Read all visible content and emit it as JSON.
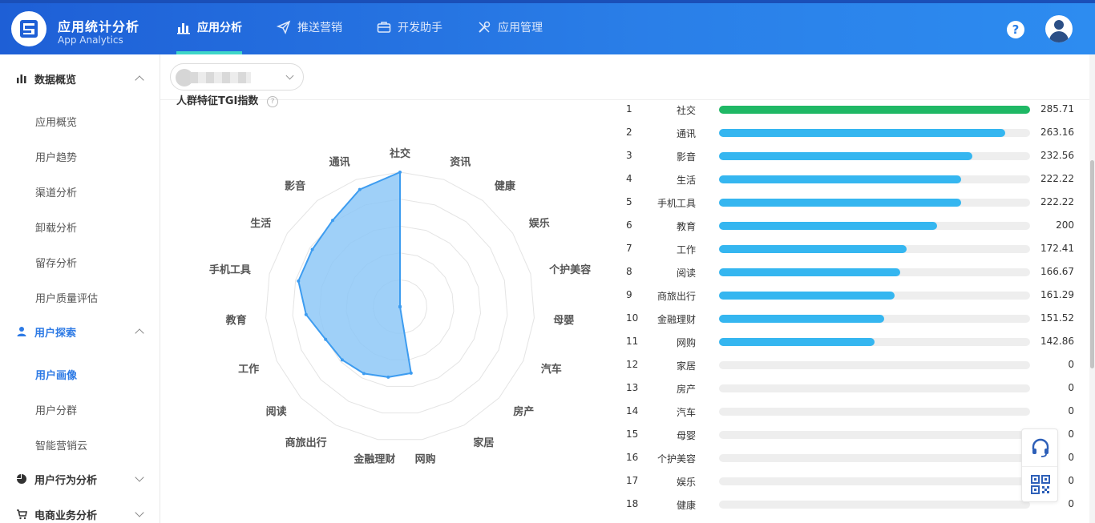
{
  "app": {
    "title": "应用统计分析",
    "subtitle": "App Analytics"
  },
  "topnav": [
    {
      "label": "应用分析",
      "icon": "bar-chart-icon",
      "active": true
    },
    {
      "label": "推送营销",
      "icon": "paper-plane-icon",
      "active": false
    },
    {
      "label": "开发助手",
      "icon": "briefcase-icon",
      "active": false
    },
    {
      "label": "应用管理",
      "icon": "tools-icon",
      "active": false
    }
  ],
  "header": {
    "help": "?",
    "help_icon": "help-circle-icon",
    "avatar_icon": "user-avatar-icon"
  },
  "sidebar": {
    "groups": [
      {
        "label": "数据概览",
        "icon": "bar-chart-icon",
        "state": "open",
        "items": [
          "应用概览",
          "用户趋势",
          "渠道分析",
          "卸载分析",
          "留存分析",
          "用户质量评估"
        ]
      },
      {
        "label": "用户探索",
        "icon": "user-icon",
        "state": "open",
        "items": [
          "用户画像",
          "用户分群",
          "智能营销云"
        ],
        "active_item": "用户画像"
      },
      {
        "label": "用户行为分析",
        "icon": "pie-chart-icon",
        "state": "closed",
        "items": []
      },
      {
        "label": "电商业务分析",
        "icon": "cart-icon",
        "state": "closed",
        "items": []
      }
    ]
  },
  "section": {
    "title": "人群特征TGI指数",
    "help_icon": "question-icon"
  },
  "colors": {
    "accent": "#2d7ae5",
    "top_bar": "#1fb865",
    "bar": "#35b6f0",
    "track": "#eeeeee",
    "radar_fill": "#8ec8f7",
    "radar_stroke": "#3d9cf0"
  },
  "chart_data": {
    "type": "radar",
    "title": "人群特征TGI指数",
    "categories": [
      "社交",
      "资讯",
      "健康",
      "娱乐",
      "个护美容",
      "母婴",
      "汽车",
      "房产",
      "家居",
      "网购",
      "金融理财",
      "商旅出行",
      "阅读",
      "工作",
      "教育",
      "手机工具",
      "生活",
      "影音",
      "通讯"
    ],
    "values": [
      285.71,
      0,
      0,
      0,
      0,
      0,
      0,
      0,
      0,
      142.86,
      151.52,
      161.29,
      166.67,
      172.41,
      200,
      222.22,
      222.22,
      232.56,
      263.16
    ],
    "max": 285.71
  },
  "ranking": [
    {
      "rank": "1",
      "label": "社交",
      "value": 285.71,
      "display": "285.71"
    },
    {
      "rank": "2",
      "label": "通讯",
      "value": 263.16,
      "display": "263.16"
    },
    {
      "rank": "3",
      "label": "影音",
      "value": 232.56,
      "display": "232.56"
    },
    {
      "rank": "4",
      "label": "生活",
      "value": 222.22,
      "display": "222.22"
    },
    {
      "rank": "5",
      "label": "手机工具",
      "value": 222.22,
      "display": "222.22"
    },
    {
      "rank": "6",
      "label": "教育",
      "value": 200,
      "display": "200"
    },
    {
      "rank": "7",
      "label": "工作",
      "value": 172.41,
      "display": "172.41"
    },
    {
      "rank": "8",
      "label": "阅读",
      "value": 166.67,
      "display": "166.67"
    },
    {
      "rank": "9",
      "label": "商旅出行",
      "value": 161.29,
      "display": "161.29"
    },
    {
      "rank": "10",
      "label": "金融理财",
      "value": 151.52,
      "display": "151.52"
    },
    {
      "rank": "11",
      "label": "网购",
      "value": 142.86,
      "display": "142.86"
    },
    {
      "rank": "12",
      "label": "家居",
      "value": 0,
      "display": "0"
    },
    {
      "rank": "13",
      "label": "房产",
      "value": 0,
      "display": "0"
    },
    {
      "rank": "14",
      "label": "汽车",
      "value": 0,
      "display": "0"
    },
    {
      "rank": "15",
      "label": "母婴",
      "value": 0,
      "display": "0"
    },
    {
      "rank": "16",
      "label": "个护美容",
      "value": 0,
      "display": "0"
    },
    {
      "rank": "17",
      "label": "娱乐",
      "value": 0,
      "display": "0"
    },
    {
      "rank": "18",
      "label": "健康",
      "value": 0,
      "display": "0"
    }
  ],
  "ranking_max": 285.71,
  "floating": {
    "support_icon": "headset-icon",
    "qr_icon": "qrcode-icon"
  }
}
